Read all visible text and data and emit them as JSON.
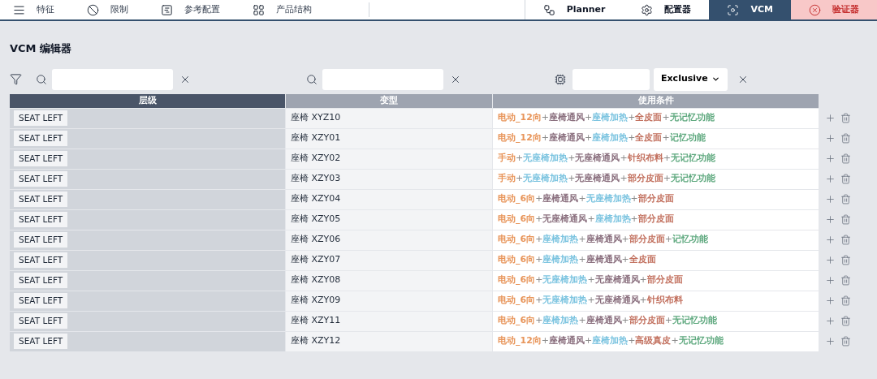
{
  "nav_left": [
    {
      "label": "特征"
    },
    {
      "label": "限制"
    },
    {
      "label": "参考配置"
    },
    {
      "label": "产品结构"
    }
  ],
  "nav_right": [
    {
      "label": "Planner",
      "kind": "plain",
      "selected": false
    },
    {
      "label": "配置器",
      "kind": "plain",
      "selected": false
    },
    {
      "label": "VCM",
      "kind": "plain",
      "selected": true
    },
    {
      "label": "验证器",
      "kind": "alert",
      "selected": false
    }
  ],
  "title": "VCM 编辑器",
  "filters": {
    "select_value": "Exclusive"
  },
  "table": {
    "columns": [
      "层级",
      "变型",
      "使用条件"
    ],
    "rows": [
      {
        "level": "SEAT LEFT",
        "variant": "座椅 XYZ10",
        "conditions": [
          {
            "kind": "term",
            "text": "电动_12向",
            "color": "#e8955a"
          },
          {
            "kind": "operator",
            "text": "+"
          },
          {
            "kind": "term",
            "text": "座椅通风",
            "color": "#8a6f7e"
          },
          {
            "kind": "operator",
            "text": "+"
          },
          {
            "kind": "term",
            "text": "座椅加热",
            "color": "#7cc4e0"
          },
          {
            "kind": "operator",
            "text": "+"
          },
          {
            "kind": "term",
            "text": "全皮面",
            "color": "#c2705e"
          },
          {
            "kind": "operator",
            "text": "+"
          },
          {
            "kind": "term",
            "text": "无记忆功能",
            "color": "#5fa97f"
          }
        ]
      },
      {
        "level": "SEAT LEFT",
        "variant": "座椅 XZY01",
        "conditions": [
          {
            "kind": "term",
            "text": "电动_12向",
            "color": "#e8955a"
          },
          {
            "kind": "operator",
            "text": "+"
          },
          {
            "kind": "term",
            "text": "座椅通风",
            "color": "#8a6f7e"
          },
          {
            "kind": "operator",
            "text": "+"
          },
          {
            "kind": "term",
            "text": "座椅加热",
            "color": "#7cc4e0"
          },
          {
            "kind": "operator",
            "text": "+"
          },
          {
            "kind": "term",
            "text": "全皮面",
            "color": "#c2705e"
          },
          {
            "kind": "operator",
            "text": "+"
          },
          {
            "kind": "term",
            "text": "记忆功能",
            "color": "#5fa97f"
          }
        ]
      },
      {
        "level": "SEAT LEFT",
        "variant": "座椅 XZY02",
        "conditions": [
          {
            "kind": "term",
            "text": "手动",
            "color": "#e8955a"
          },
          {
            "kind": "operator",
            "text": "+"
          },
          {
            "kind": "term",
            "text": "无座椅加热",
            "color": "#7cc4e0"
          },
          {
            "kind": "operator",
            "text": "+"
          },
          {
            "kind": "term",
            "text": "无座椅通风",
            "color": "#8a6f7e"
          },
          {
            "kind": "operator",
            "text": "+"
          },
          {
            "kind": "term",
            "text": "针织布料",
            "color": "#c2705e"
          },
          {
            "kind": "operator",
            "text": "+"
          },
          {
            "kind": "term",
            "text": "无记忆功能",
            "color": "#5fa97f"
          }
        ]
      },
      {
        "level": "SEAT LEFT",
        "variant": "座椅 XZY03",
        "conditions": [
          {
            "kind": "term",
            "text": "手动",
            "color": "#e8955a"
          },
          {
            "kind": "operator",
            "text": "+"
          },
          {
            "kind": "term",
            "text": "无座椅加热",
            "color": "#7cc4e0"
          },
          {
            "kind": "operator",
            "text": "+"
          },
          {
            "kind": "term",
            "text": "无座椅通风",
            "color": "#8a6f7e"
          },
          {
            "kind": "operator",
            "text": "+"
          },
          {
            "kind": "term",
            "text": "部分皮面",
            "color": "#c2705e"
          },
          {
            "kind": "operator",
            "text": "+"
          },
          {
            "kind": "term",
            "text": "无记忆功能",
            "color": "#5fa97f"
          }
        ]
      },
      {
        "level": "SEAT LEFT",
        "variant": "座椅 XZY04",
        "conditions": [
          {
            "kind": "term",
            "text": "电动_6向",
            "color": "#e8955a"
          },
          {
            "kind": "operator",
            "text": "+"
          },
          {
            "kind": "term",
            "text": "座椅通风",
            "color": "#8a6f7e"
          },
          {
            "kind": "operator",
            "text": "+"
          },
          {
            "kind": "term",
            "text": "无座椅加热",
            "color": "#7cc4e0"
          },
          {
            "kind": "operator",
            "text": "+"
          },
          {
            "kind": "term",
            "text": "部分皮面",
            "color": "#c2705e"
          }
        ]
      },
      {
        "level": "SEAT LEFT",
        "variant": "座椅 XZY05",
        "conditions": [
          {
            "kind": "term",
            "text": "电动_6向",
            "color": "#e8955a"
          },
          {
            "kind": "operator",
            "text": "+"
          },
          {
            "kind": "term",
            "text": "无座椅通风",
            "color": "#8a6f7e"
          },
          {
            "kind": "operator",
            "text": "+"
          },
          {
            "kind": "term",
            "text": "座椅加热",
            "color": "#7cc4e0"
          },
          {
            "kind": "operator",
            "text": "+"
          },
          {
            "kind": "term",
            "text": "部分皮面",
            "color": "#c2705e"
          }
        ]
      },
      {
        "level": "SEAT LEFT",
        "variant": "座椅 XZY06",
        "conditions": [
          {
            "kind": "term",
            "text": "电动_6向",
            "color": "#e8955a"
          },
          {
            "kind": "operator",
            "text": "+"
          },
          {
            "kind": "term",
            "text": "座椅加热",
            "color": "#7cc4e0"
          },
          {
            "kind": "operator",
            "text": "+"
          },
          {
            "kind": "term",
            "text": "座椅通风",
            "color": "#8a6f7e"
          },
          {
            "kind": "operator",
            "text": "+"
          },
          {
            "kind": "term",
            "text": "部分皮面",
            "color": "#c2705e"
          },
          {
            "kind": "operator",
            "text": "+"
          },
          {
            "kind": "term",
            "text": "记忆功能",
            "color": "#5fa97f"
          }
        ]
      },
      {
        "level": "SEAT LEFT",
        "variant": "座椅 XZY07",
        "conditions": [
          {
            "kind": "term",
            "text": "电动_6向",
            "color": "#e8955a"
          },
          {
            "kind": "operator",
            "text": "+"
          },
          {
            "kind": "term",
            "text": "座椅加热",
            "color": "#7cc4e0"
          },
          {
            "kind": "operator",
            "text": "+"
          },
          {
            "kind": "term",
            "text": "座椅通风",
            "color": "#8a6f7e"
          },
          {
            "kind": "operator",
            "text": "+"
          },
          {
            "kind": "term",
            "text": "全皮面",
            "color": "#c2705e"
          }
        ]
      },
      {
        "level": "SEAT LEFT",
        "variant": "座椅 XZY08",
        "conditions": [
          {
            "kind": "term",
            "text": "电动_6向",
            "color": "#e8955a"
          },
          {
            "kind": "operator",
            "text": "+"
          },
          {
            "kind": "term",
            "text": "无座椅加热",
            "color": "#7cc4e0"
          },
          {
            "kind": "operator",
            "text": "+"
          },
          {
            "kind": "term",
            "text": "无座椅通风",
            "color": "#8a6f7e"
          },
          {
            "kind": "operator",
            "text": "+"
          },
          {
            "kind": "term",
            "text": "部分皮面",
            "color": "#c2705e"
          }
        ]
      },
      {
        "level": "SEAT LEFT",
        "variant": "座椅 XZY09",
        "conditions": [
          {
            "kind": "term",
            "text": "电动_6向",
            "color": "#e8955a"
          },
          {
            "kind": "operator",
            "text": "+"
          },
          {
            "kind": "term",
            "text": "无座椅加热",
            "color": "#7cc4e0"
          },
          {
            "kind": "operator",
            "text": "+"
          },
          {
            "kind": "term",
            "text": "无座椅通风",
            "color": "#8a6f7e"
          },
          {
            "kind": "operator",
            "text": "+"
          },
          {
            "kind": "term",
            "text": "针织布料",
            "color": "#c2705e"
          }
        ]
      },
      {
        "level": "SEAT LEFT",
        "variant": "座椅 XZY11",
        "conditions": [
          {
            "kind": "term",
            "text": "电动_6向",
            "color": "#e8955a"
          },
          {
            "kind": "operator",
            "text": "+"
          },
          {
            "kind": "term",
            "text": "座椅加热",
            "color": "#7cc4e0"
          },
          {
            "kind": "operator",
            "text": "+"
          },
          {
            "kind": "term",
            "text": "座椅通风",
            "color": "#8a6f7e"
          },
          {
            "kind": "operator",
            "text": "+"
          },
          {
            "kind": "term",
            "text": "部分皮面",
            "color": "#c2705e"
          },
          {
            "kind": "operator",
            "text": "+"
          },
          {
            "kind": "term",
            "text": "无记忆功能",
            "color": "#5fa97f"
          }
        ]
      },
      {
        "level": "SEAT LEFT",
        "variant": "座椅 XZY12",
        "conditions": [
          {
            "kind": "term",
            "text": "电动_12向",
            "color": "#e8955a"
          },
          {
            "kind": "operator",
            "text": "+"
          },
          {
            "kind": "term",
            "text": "座椅通风",
            "color": "#8a6f7e"
          },
          {
            "kind": "operator",
            "text": "+"
          },
          {
            "kind": "term",
            "text": "座椅加热",
            "color": "#7cc4e0"
          },
          {
            "kind": "operator",
            "text": "+"
          },
          {
            "kind": "term",
            "text": "高级真皮",
            "color": "#c2705e"
          },
          {
            "kind": "operator",
            "text": "+"
          },
          {
            "kind": "term",
            "text": "无记忆功能",
            "color": "#5fa97f"
          }
        ]
      }
    ]
  }
}
